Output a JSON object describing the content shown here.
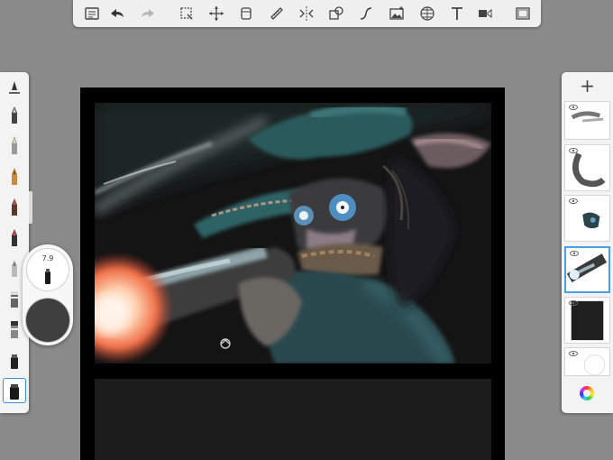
{
  "toolbar": {
    "items": [
      "menu-icon",
      "undo-icon",
      "redo-icon",
      "selection-icon",
      "transform-icon",
      "stack-icon",
      "ruler-icon",
      "symmetry-icon",
      "shapes-icon",
      "curve-icon",
      "image-icon",
      "perspective-icon",
      "text-icon",
      "video-icon",
      "fullscreen-icon"
    ]
  },
  "brush_palette": {
    "items": [
      "brush-library",
      "ballpoint-pen",
      "pencil",
      "fine-pencil",
      "marker",
      "airbrush",
      "paintbrush",
      "soft-pencil",
      "chisel-pencil",
      "felt-pen",
      "eraser",
      "selected-brush"
    ],
    "selected_index": 11
  },
  "brush_puck": {
    "size_value": "7.9",
    "color": "#3f3f3f"
  },
  "layers": {
    "add_label": "+",
    "selected_index": 3,
    "count": 6
  },
  "colors": {
    "background": "#8a8a8a",
    "accent": "#3a8ee0"
  }
}
